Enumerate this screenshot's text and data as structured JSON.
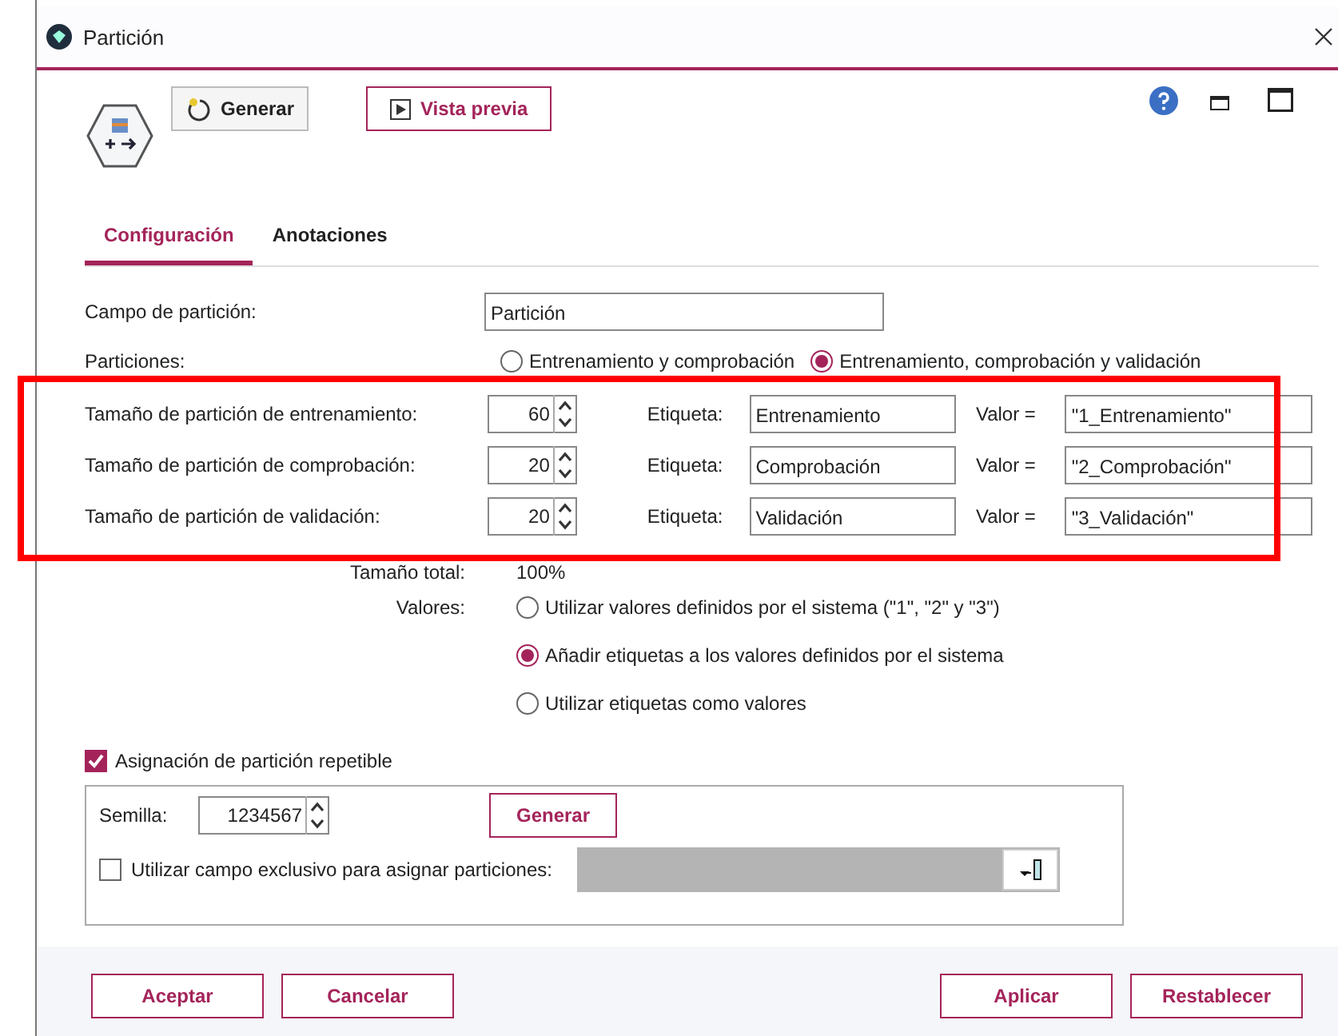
{
  "window": {
    "title": "Partición"
  },
  "toolbar": {
    "buttons": [
      {
        "kind": "generate",
        "label": "Generar"
      },
      {
        "kind": "preview",
        "label": "Vista previa"
      }
    ]
  },
  "tabs": [
    {
      "label": "Configuración",
      "selected": true
    },
    {
      "label": "Anotaciones",
      "selected": false
    }
  ],
  "partition_field": {
    "label": "Campo de partición:",
    "value": "Partición"
  },
  "partitions": {
    "label": "Particiones:",
    "options": [
      {
        "label": "Entrenamiento y comprobación",
        "selected": false
      },
      {
        "label": "Entrenamiento, comprobación y validación",
        "selected": true
      }
    ]
  },
  "sizes": [
    {
      "label": "Tamaño de partición de entrenamiento:",
      "size": "60",
      "tag_label": "Etiqueta:",
      "tag": "Entrenamiento",
      "value_label": "Valor =",
      "value": "\"1_Entrenamiento\""
    },
    {
      "label": "Tamaño de partición de comprobación:",
      "size": "20",
      "tag_label": "Etiqueta:",
      "tag": "Comprobación",
      "value_label": "Valor =",
      "value": "\"2_Comprobación\""
    },
    {
      "label": "Tamaño de partición de validación:",
      "size": "20",
      "tag_label": "Etiqueta:",
      "tag": "Validación",
      "value_label": "Valor =",
      "value": "\"3_Validación\""
    }
  ],
  "total": {
    "label": "Tamaño total:",
    "value": "100%"
  },
  "values": {
    "label": "Valores:",
    "options": [
      {
        "label": "Utilizar valores definidos por el sistema (\"1\", \"2\" y \"3\")",
        "selected": false
      },
      {
        "label": "Añadir etiquetas a los valores definidos por el sistema",
        "selected": true
      },
      {
        "label": "Utilizar etiquetas como valores",
        "selected": false
      }
    ]
  },
  "repeatable": {
    "label": "Asignación de partición repetible",
    "checked": true
  },
  "seed": {
    "label": "Semilla:",
    "value": "1234567",
    "button": "Generar"
  },
  "exclusive_field": {
    "label": "Utilizar campo exclusivo para asignar particiones:",
    "checked": false
  },
  "footer": {
    "left": [
      "Aceptar",
      "Cancelar"
    ],
    "right": [
      "Aplicar",
      "Restablecer"
    ]
  }
}
